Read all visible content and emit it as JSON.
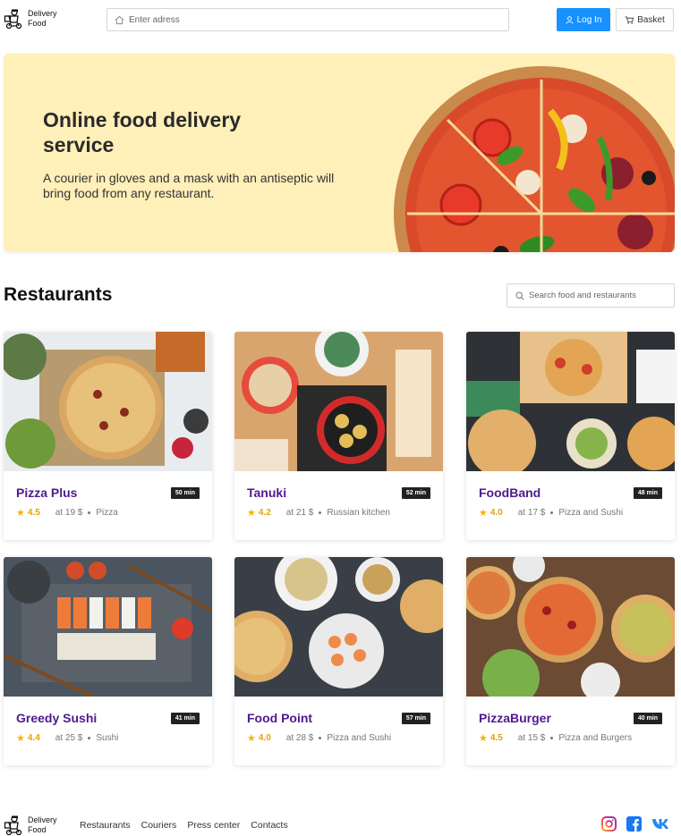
{
  "header": {
    "logo_line1": "Delivery",
    "logo_line2": "Food",
    "address_placeholder": "Enter adress",
    "login_label": "Log In",
    "basket_label": "Basket"
  },
  "promo": {
    "title": "Online food delivery service",
    "text": "A courier in gloves and a mask with an antiseptic will bring food from any restaurant."
  },
  "restaurants": {
    "title": "Restaurants",
    "search_placeholder": "Search food and restaurants",
    "items": [
      {
        "name": "Pizza Plus",
        "time": "50 min",
        "rating": "4.5",
        "price": "at 19 $",
        "category": "Pizza"
      },
      {
        "name": "Tanuki",
        "time": "52 min",
        "rating": "4.2",
        "price": "at 21 $",
        "category": "Russian kitchen"
      },
      {
        "name": "FoodBand",
        "time": "48 min",
        "rating": "4.0",
        "price": "at 17 $",
        "category": "Pizza and Sushi"
      },
      {
        "name": "Greedy Sushi",
        "time": "41 min",
        "rating": "4.4",
        "price": "at 25 $",
        "category": "Sushi"
      },
      {
        "name": "Food Point",
        "time": "57 min",
        "rating": "4.0",
        "price": "at 28 $",
        "category": "Pizza and Sushi"
      },
      {
        "name": "PizzaBurger",
        "time": "40 min",
        "rating": "4.5",
        "price": "at 15 $",
        "category": "Pizza and Burgers"
      }
    ]
  },
  "footer": {
    "logo_line1": "Delivery",
    "logo_line2": "Food",
    "nav": [
      "Restaurants",
      "Couriers",
      "Press center",
      "Contacts"
    ],
    "socials": [
      "instagram-icon",
      "facebook-icon",
      "vk-icon"
    ]
  },
  "colors": {
    "accent": "#1890ff",
    "promo_bg": "#ffefb9",
    "restaurant_name": "#4e1a8c",
    "rating": "#e8a200"
  }
}
